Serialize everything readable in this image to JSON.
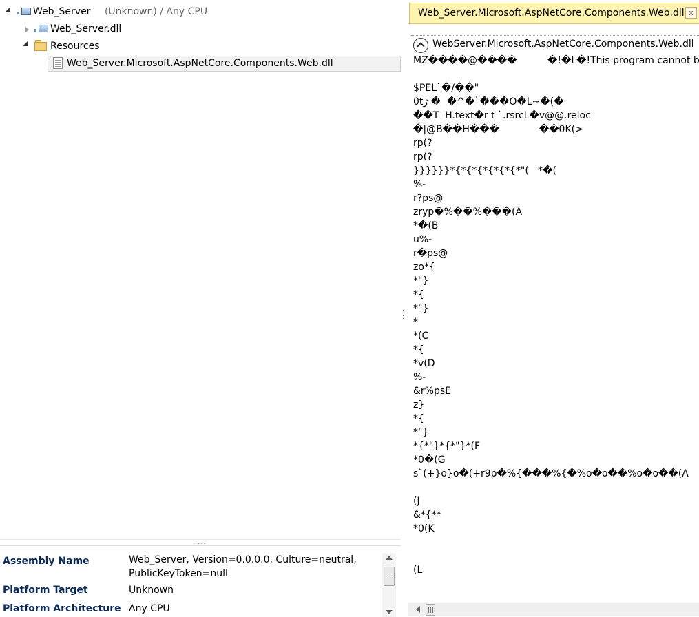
{
  "tree": {
    "root": {
      "label": "Web_Server",
      "meta": "(Unknown) / Any CPU"
    },
    "dll": {
      "label": "Web_Server.dll"
    },
    "resources": {
      "label": "Resources"
    },
    "resource_item": {
      "label": "Web_Server.Microsoft.AspNetCore.Components.Web.dll"
    }
  },
  "properties": {
    "assembly_name": {
      "name": "Assembly Name",
      "value_line1": "Web_Server, Version=0.0.0.0, Culture=neutral,",
      "value_line2": "PublicKeyToken=null"
    },
    "platform_target": {
      "name": "Platform Target",
      "value": "Unknown"
    },
    "platform_arch": {
      "name": "Platform Architecture",
      "value": "Any CPU"
    }
  },
  "editor": {
    "tab_title": "Web_Server.Microsoft.AspNetCore.Components.Web.dll",
    "tab_close": "x",
    "resource_title": "WebServer.Microsoft.AspNetCore.Components.Web.dll",
    "dump": "MZ����@����          �!�L�!This program cannot be run\n\n$PEL`�/��\"\n0tڑ �  �^�`���O�L~�(�\n��T  H.text�r t `.rsrcL�v@@.reloc\n�|@B��H���             ��0K(>\nrp(?\nrp(?\n}}}}}}*{*{*{*{*{*{*\"(   *�(\n%-\nr?ps@\nzryp�%��%���(A\n*�(B\nu%-\nr�ps@\nzo*{\n*\"}\n*{\n*\"}\n*\n*(C\n*{\n*v(D\n%-\n&r%psE\nz}\n*{\n*\"}\n*{*\"}*{*\"}*(F\n*0�(G\ns`(+}o}o�(+r9p�%{���%{�%o�o��%o�o��(A\n\n(J\n&*{**\n*0(K\n\n\n(L\n\n\no*Z,\n{oM"
  }
}
